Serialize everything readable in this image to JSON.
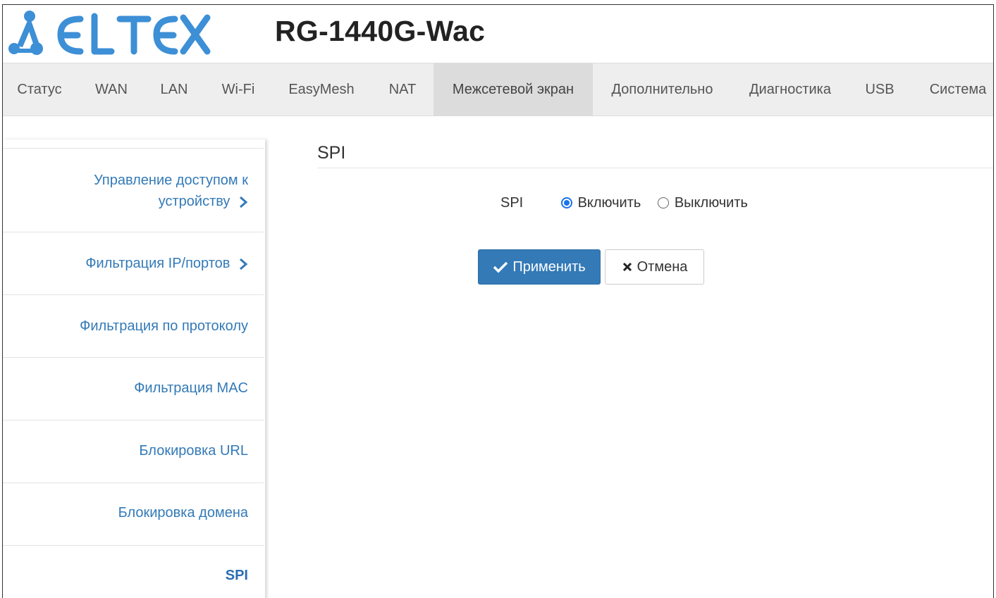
{
  "header": {
    "logo_text": "ELTEX",
    "model": "RG-1440G-Wac"
  },
  "nav": {
    "items": [
      {
        "label": "Статус"
      },
      {
        "label": "WAN"
      },
      {
        "label": "LAN"
      },
      {
        "label": "Wi-Fi"
      },
      {
        "label": "EasyMesh"
      },
      {
        "label": "NAT"
      },
      {
        "label": "Межсетевой экран"
      },
      {
        "label": "Дополнительно"
      },
      {
        "label": "Диагностика"
      },
      {
        "label": "USB"
      },
      {
        "label": "Система"
      }
    ],
    "active": "Межсетевой экран"
  },
  "sidebar": {
    "items": [
      {
        "label_line1": "Управление доступом к",
        "label_line2": "устройству"
      },
      {
        "label": "Фильтрация IP/портов"
      },
      {
        "label": "Фильтрация по протоколу"
      },
      {
        "label": "Фильтрация MAC"
      },
      {
        "label": "Блокировка URL"
      },
      {
        "label": "Блокировка домена"
      },
      {
        "label": "SPI"
      }
    ],
    "active": "SPI"
  },
  "main": {
    "title": "SPI",
    "spi_label": "SPI",
    "enable_label": "Включить",
    "disable_label": "Выключить",
    "selected": "Включить",
    "apply_label": "Применить",
    "cancel_label": "Отмена"
  },
  "colors": {
    "logo_blue": "#3d8fd6",
    "link_blue": "#337ab7",
    "button_primary": "#337ab7",
    "radio_active": "#1a73e8"
  }
}
